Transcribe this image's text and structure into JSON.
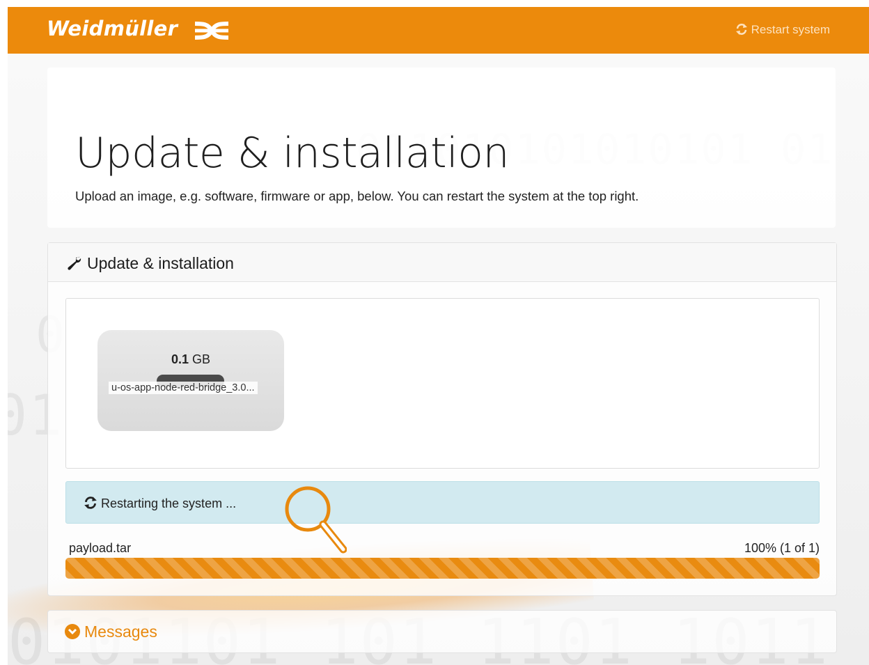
{
  "header": {
    "brand": "Weidmüller",
    "restart_label": "Restart system"
  },
  "jumbotron": {
    "title": "Update & installation",
    "subtitle": "Upload an image, e.g. software, firmware or app, below. You can restart the system at the top right."
  },
  "panel": {
    "title": "Update & installation",
    "file": {
      "size_value": "0.1",
      "size_unit": "GB",
      "name": "u-os-app-node-red-bridge_3.0..."
    },
    "alert": {
      "text": "Restarting the system ..."
    },
    "progress": {
      "filename": "payload.tar",
      "percent_text": "100% (1 of 1)",
      "value": 1.0
    }
  },
  "messages": {
    "title": "Messages"
  },
  "colors": {
    "accent": "#ec8a0c",
    "alert_bg": "#d2eaf0",
    "progress": "#e98b10"
  },
  "icons": [
    "brand-logo-icon",
    "refresh-icon",
    "wrench-icon",
    "search-icon",
    "chevron-down-icon"
  ]
}
